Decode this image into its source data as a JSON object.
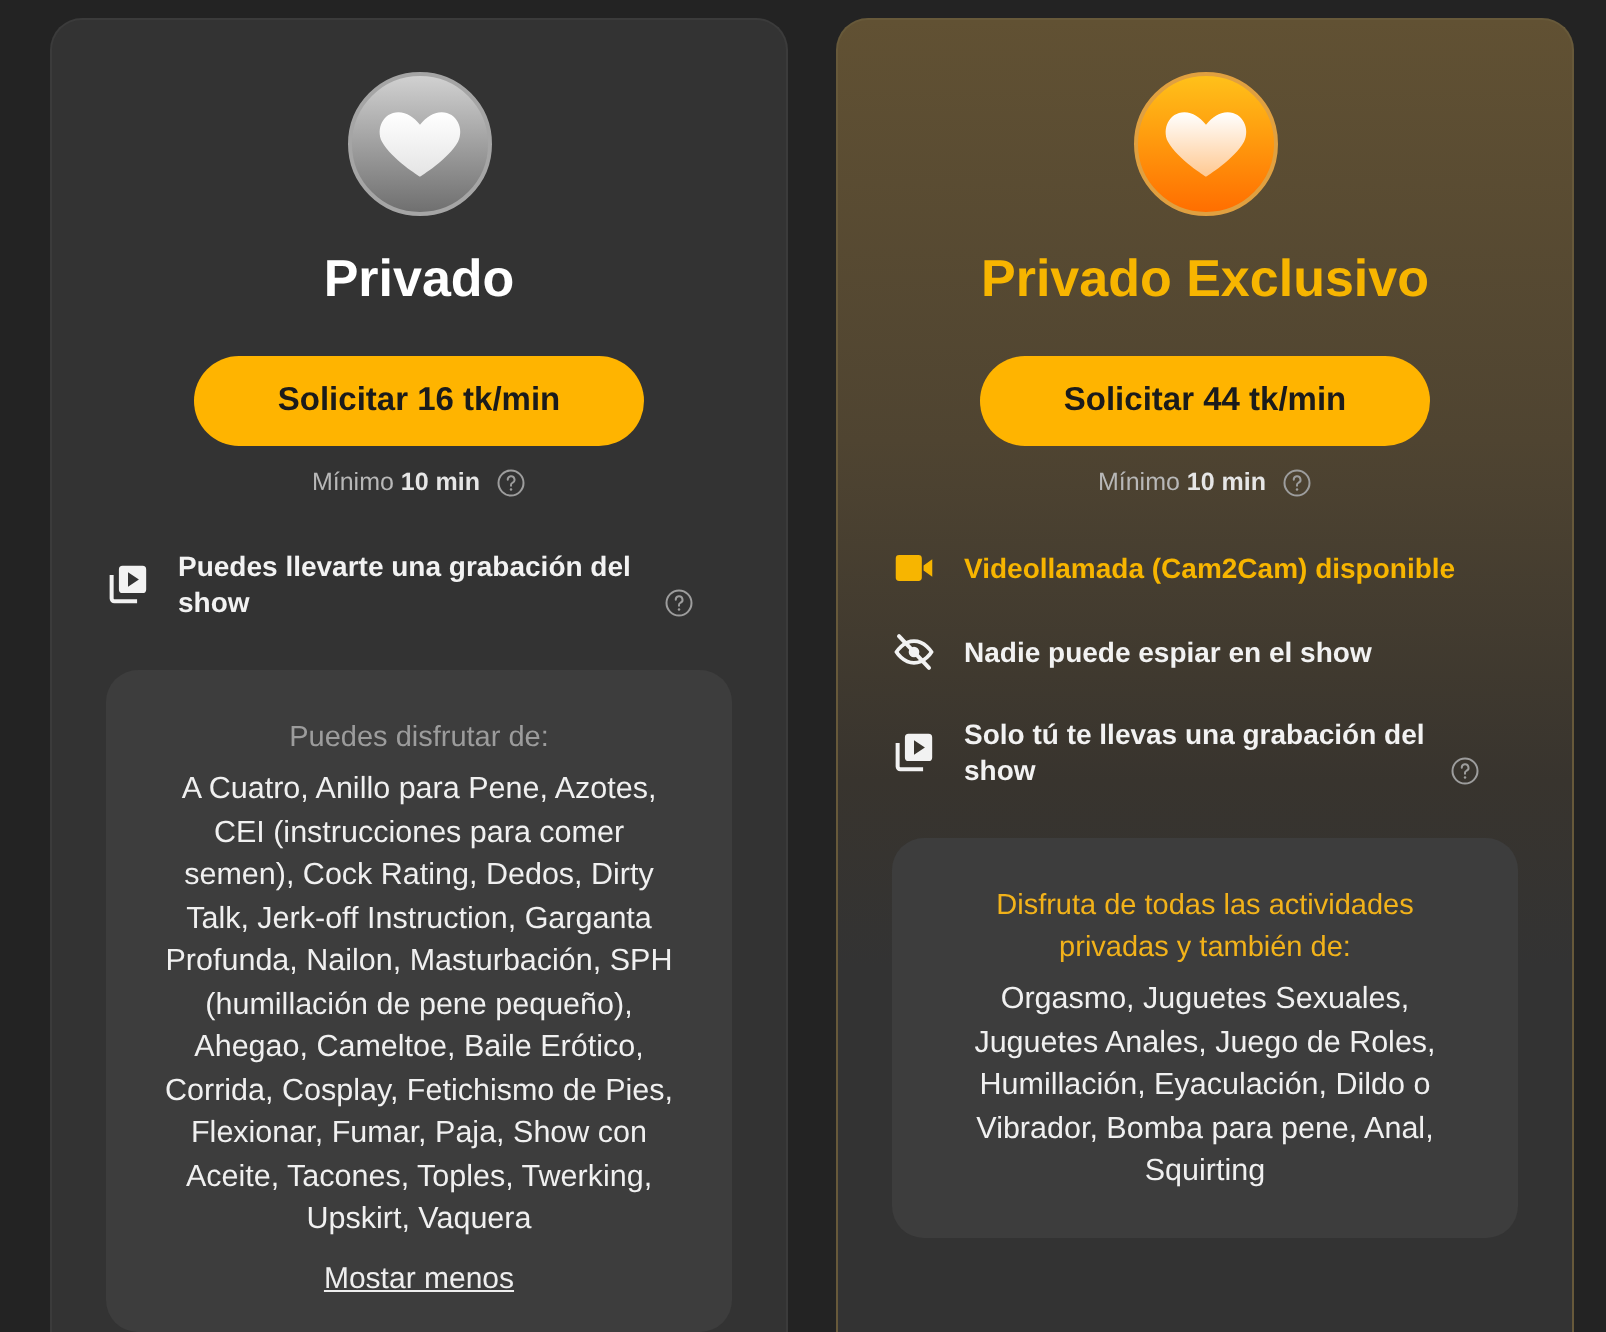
{
  "plans": [
    {
      "kind": "standard",
      "title": "Privado",
      "button": "Solicitar 16 tk/min",
      "minimum": {
        "text": "Mínimo **10 min**",
        "help": true
      },
      "features": [
        {
          "kind": "recording",
          "text": "Puedes llevarte una grabación del show",
          "help": true,
          "highlighted": false
        }
      ],
      "activities": {
        "heading": "Puedes disfrutar de:",
        "text": "A Cuatro, Anillo para Pene, Azotes, CEI (instrucciones para comer semen), Cock Rating, Dedos, Dirty Talk, Jerk-off Instruction, Garganta Profunda, Nailon, Masturbación, SPH (humillación de pene pequeño), Ahegao, Cameltoe, Baile Erótico, Corrida, Cosplay, Fetichismo de Pies, Flexionar, Fumar, Paja, Show con Aceite, Tacones, Toples, Twerking, Upskirt, Vaquera",
        "toggle": "Mostar menos"
      }
    },
    {
      "kind": "exclusive",
      "title": "Privado Exclusivo",
      "button": "Solicitar 44 tk/min",
      "minimum": {
        "text": "Mínimo **10 min**",
        "help": true
      },
      "features": [
        {
          "kind": "video",
          "text": "Videollamada (Cam2Cam) disponible",
          "help": false,
          "highlighted": true
        },
        {
          "kind": "hidden",
          "text": "Nadie puede espiar en el show",
          "help": false,
          "highlighted": false
        },
        {
          "kind": "recording",
          "text": "Solo tú te llevas una grabación del show",
          "help": true,
          "highlighted": false
        }
      ],
      "activities": {
        "heading": "Disfruta de todas las actividades privadas y también de:",
        "text": "Orgasmo, Juguetes Sexuales, Juguetes Anales, Juego de Roles, Humillación, Eyaculación, Dildo o Vibrador, Bomba para pene, Anal, Squirting"
      }
    }
  ]
}
